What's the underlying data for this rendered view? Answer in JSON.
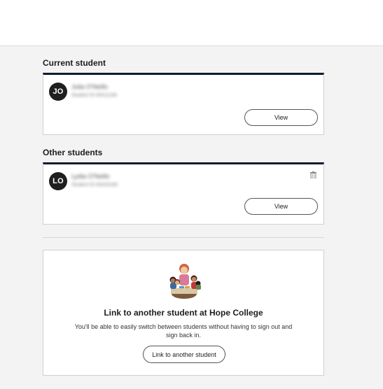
{
  "current_section": {
    "heading": "Current student",
    "student": {
      "initials": "JO",
      "name": "Julia O'Neills",
      "id_line": "Student ID 00411180",
      "view_label": "View"
    }
  },
  "other_section": {
    "heading": "Other students",
    "student": {
      "initials": "LO",
      "name": "Lydia O'Neills",
      "id_line": "Student ID 00433180",
      "view_label": "View",
      "delete_icon": "trash-icon"
    }
  },
  "promo": {
    "illustration": "students-illustration",
    "title": "Link to another student at Hope College",
    "description": "You'll be able to easily switch between students without having to sign out and sign back in.",
    "button_label": "Link to another student"
  },
  "colors": {
    "card_accent": "#0d1b33",
    "avatar_bg": "#1f1f1f",
    "page_bg": "#f3f3f3"
  }
}
